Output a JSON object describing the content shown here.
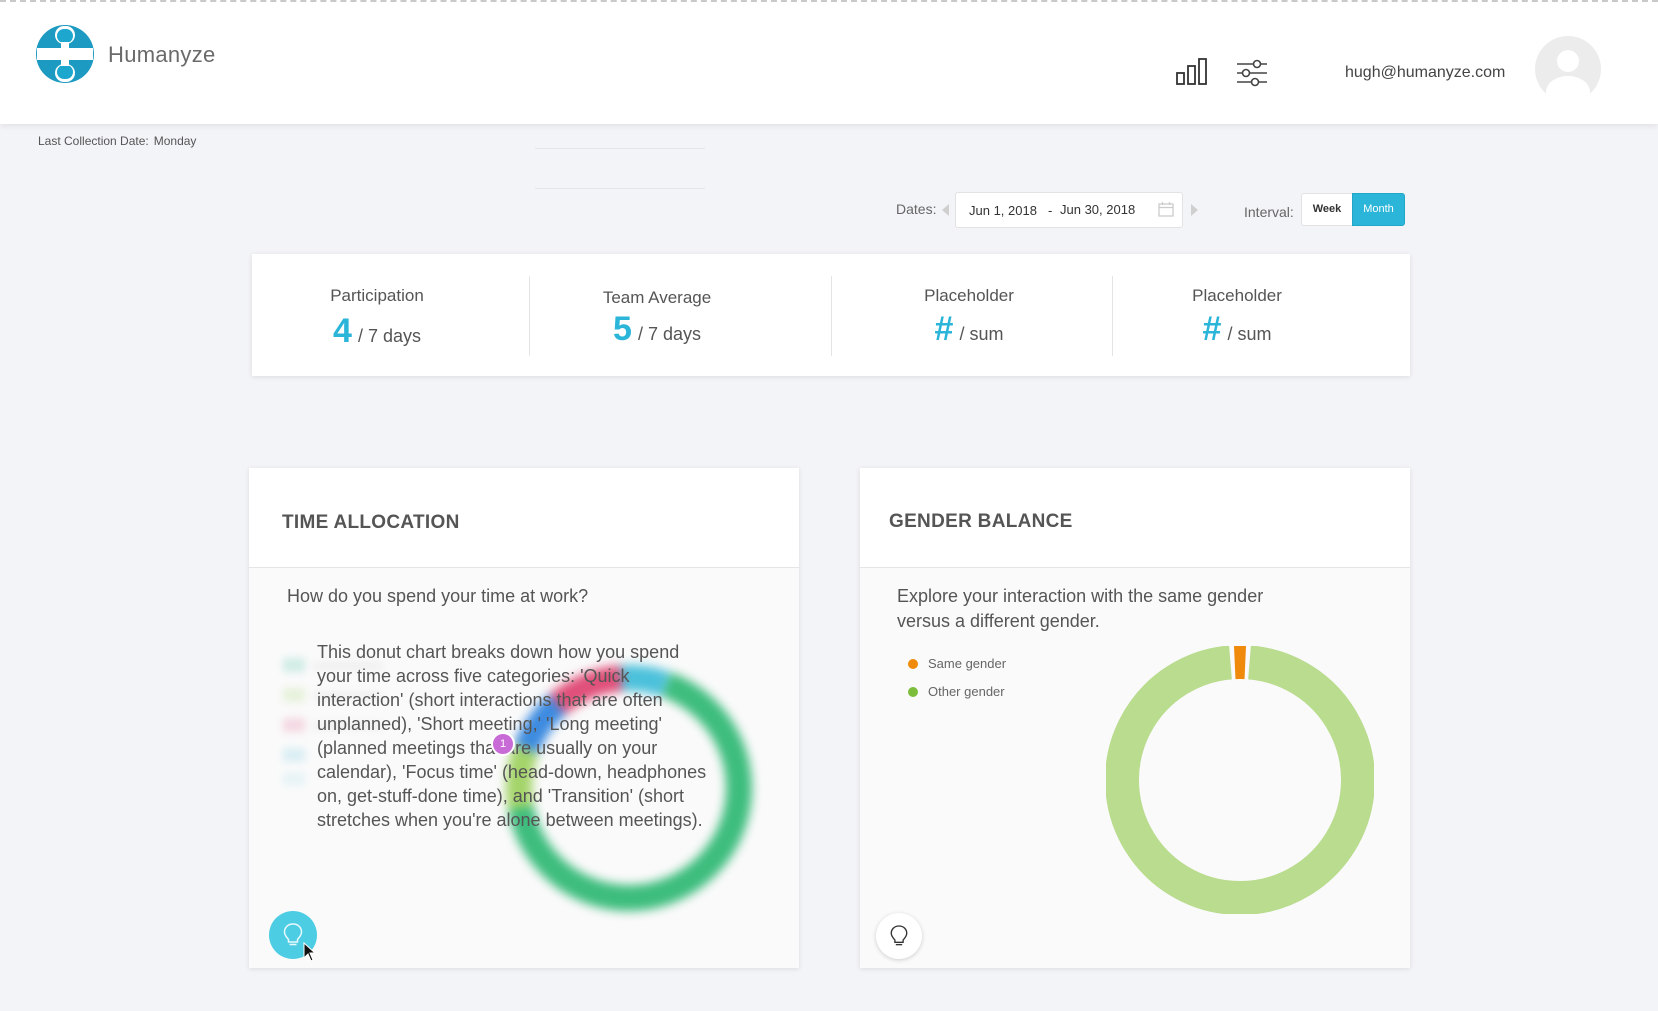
{
  "app": {
    "name": "Humanyze"
  },
  "header": {
    "user_email": "hugh@humanyze.com"
  },
  "collection": {
    "label": "Last Collection Date:",
    "value": "Monday"
  },
  "dates": {
    "label": "Dates:",
    "start": "Jun 1, 2018",
    "separator": "-",
    "end": "Jun 30, 2018",
    "interval_label": "Interval:",
    "interval_options": [
      "Week",
      "Month"
    ],
    "interval_selected": "Month"
  },
  "stats": [
    {
      "title": "Participation",
      "value": "4",
      "unit": "/ 7 days"
    },
    {
      "title": "Team Average",
      "value": "5",
      "unit": "/ 7 days"
    },
    {
      "title": "Placeholder",
      "value": "#",
      "unit": "/ sum"
    },
    {
      "title": "Placeholder",
      "value": "#",
      "unit": "/ sum"
    }
  ],
  "time_allocation": {
    "title": "TIME ALLOCATION",
    "subtitle": "How do you spend your time at work?",
    "tip_text": "This donut chart breaks down how you spend your time across five categories: 'Quick interaction' (short interactions that are often unplanned), 'Short meeting,' 'Long meeting' (planned meetings that are usually on your calendar), 'Focus time' (head-down, headphones on, get-stuff-done time), and 'Transition' (short stretches when you're alone between meetings).",
    "step_number": "1"
  },
  "gender_balance": {
    "title": "GENDER BALANCE",
    "subtitle": "Explore your interaction with the same gender versus a different gender.",
    "legend": [
      {
        "label": "Same gender",
        "color": "#f08a0a"
      },
      {
        "label": "Other gender",
        "color": "#7cbd3c"
      }
    ],
    "chart_data": {
      "type": "pie",
      "categories": [
        "Same gender",
        "Other gender"
      ],
      "values": [
        2,
        98
      ],
      "colors": [
        "#f08a0a",
        "#b9dc8e"
      ]
    }
  },
  "colors": {
    "accent": "#2bb5d8",
    "bulb_active": "#4dcde3"
  }
}
